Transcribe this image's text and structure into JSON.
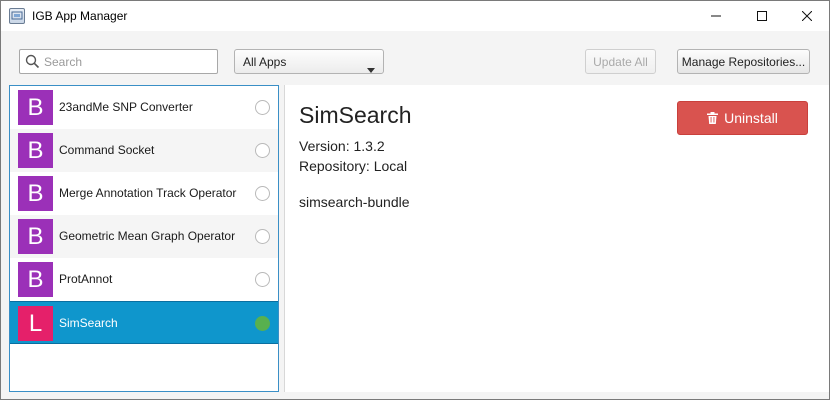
{
  "window": {
    "title": "IGB App Manager",
    "controls": [
      "minimize-icon",
      "maximize-icon",
      "close-icon"
    ]
  },
  "toolbar": {
    "search_placeholder": "Search",
    "search_value": "",
    "filter_selected": "All Apps",
    "update_all_label": "Update All",
    "manage_repos_label": "Manage Repositories..."
  },
  "apps": [
    {
      "badge": "B",
      "badge_color": "#9b30b8",
      "name": "23andMe SNP Converter",
      "selected": false
    },
    {
      "badge": "B",
      "badge_color": "#9b30b8",
      "name": "Command Socket",
      "selected": false
    },
    {
      "badge": "B",
      "badge_color": "#9b30b8",
      "name": "Merge Annotation Track Operator",
      "selected": false
    },
    {
      "badge": "B",
      "badge_color": "#9b30b8",
      "name": "Geometric Mean Graph Operator",
      "selected": false
    },
    {
      "badge": "B",
      "badge_color": "#9b30b8",
      "name": "ProtAnnot",
      "selected": false
    },
    {
      "badge": "L",
      "badge_color": "#e5206a",
      "name": "SimSearch",
      "selected": true
    }
  ],
  "details": {
    "title": "SimSearch",
    "version": "Version: 1.3.2",
    "repository": "Repository: Local",
    "description": "simsearch-bundle",
    "uninstall_label": "Uninstall",
    "uninstall_icon": "trash-icon"
  },
  "colors": {
    "selection": "#0f96cc",
    "installed": "#58b04f",
    "uninstall": "#d9534f"
  }
}
